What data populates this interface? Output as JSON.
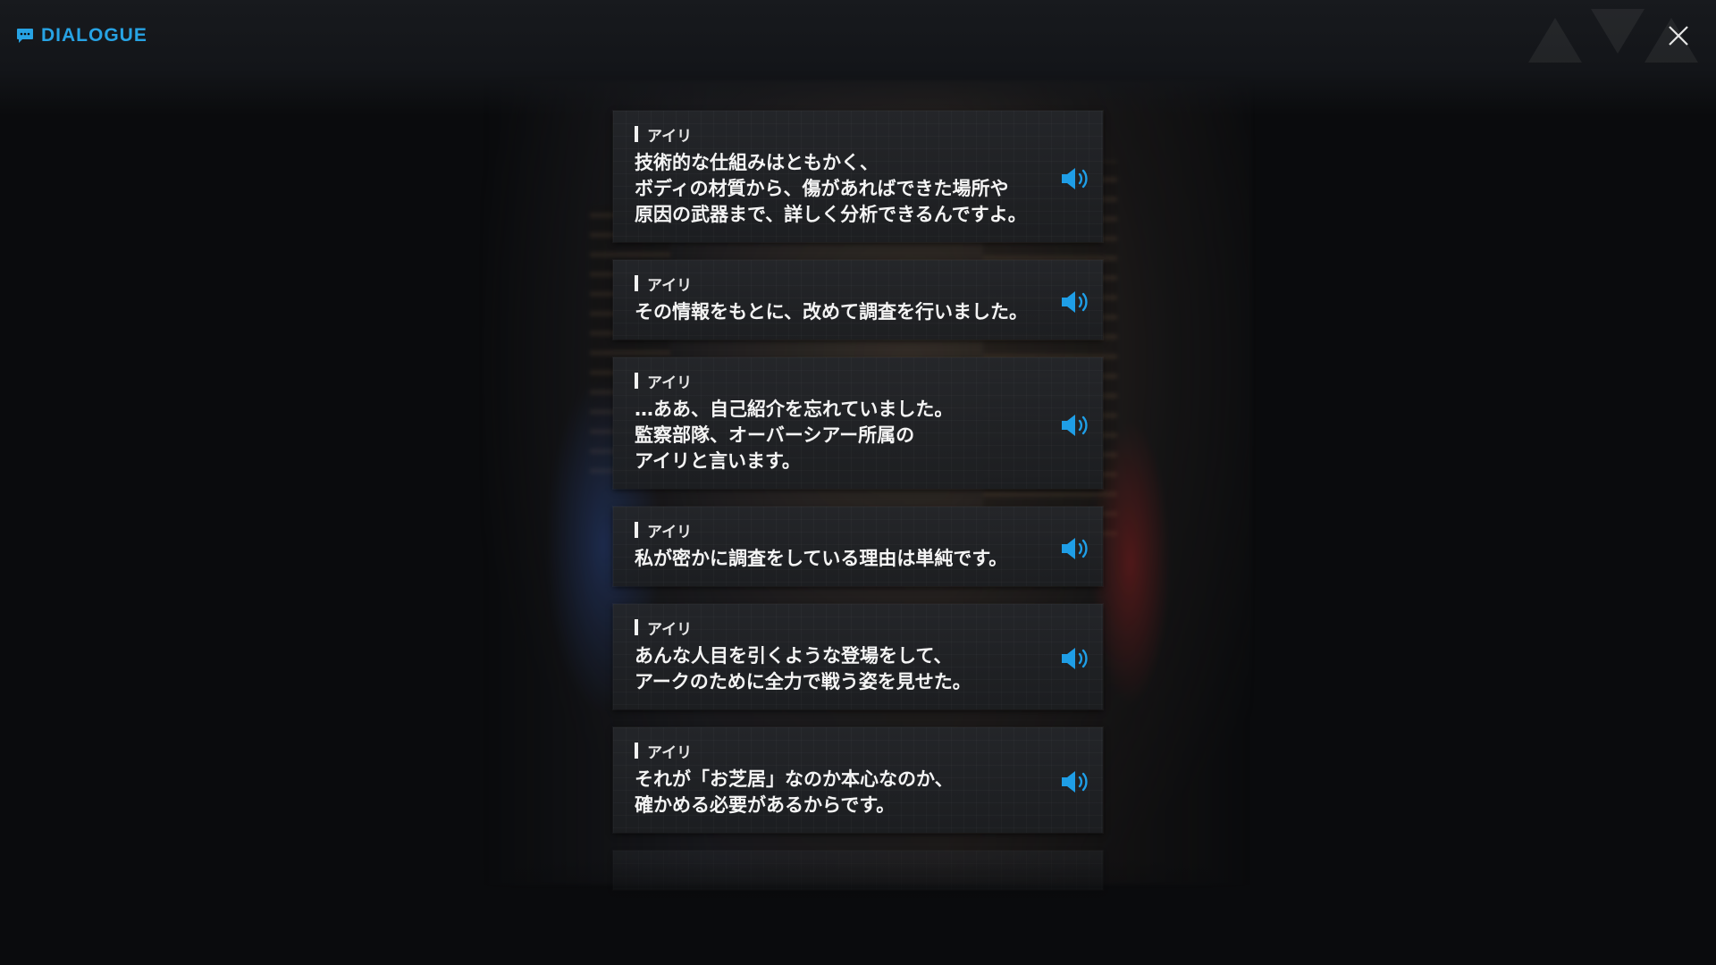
{
  "header": {
    "title": "DIALOGUE",
    "title_icon": "chat-bubble-icon",
    "close_icon": "close-icon",
    "accent_color": "#27a3e4"
  },
  "dialogue": [
    {
      "speaker": "アイリ",
      "lines": [
        "技術的な仕組みはともかく、",
        "ボディの材質から、傷があればできた場所や",
        "原因の武器まで、詳しく分析できるんですよ。"
      ]
    },
    {
      "speaker": "アイリ",
      "lines": [
        "その情報をもとに、改めて調査を行いました。"
      ]
    },
    {
      "speaker": "アイリ",
      "lines": [
        "…ああ、自己紹介を忘れていました。",
        "監察部隊、オーバーシアー所属の",
        "アイリと言います。"
      ]
    },
    {
      "speaker": "アイリ",
      "lines": [
        "私が密かに調査をしている理由は単純です。"
      ]
    },
    {
      "speaker": "アイリ",
      "lines": [
        "あんな人目を引くような登場をして、",
        "アークのために全力で戦う姿を見せた。"
      ]
    },
    {
      "speaker": "アイリ",
      "lines": [
        "それが「お芝居」なのか本心なのか、",
        "確かめる必要があるからです。"
      ]
    }
  ],
  "voice_icon": "speaker-volume-icon",
  "voice_color": "#1f9ee6"
}
